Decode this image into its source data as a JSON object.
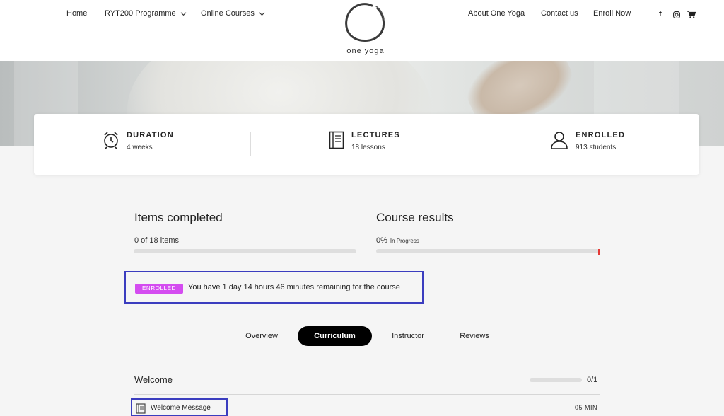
{
  "nav": {
    "home": "Home",
    "programme": "RYT200 Programme",
    "courses": "Online Courses",
    "about": "About One Yoga",
    "contact": "Contact us",
    "enroll": "Enroll Now"
  },
  "logo": {
    "text": "one yoga"
  },
  "social": {
    "facebook": "f",
    "instagram": "instagram-icon",
    "cart": "cart-icon"
  },
  "stats": {
    "duration": {
      "title": "DURATION",
      "value": "4 weeks",
      "icon": "alarm-clock-icon"
    },
    "lectures": {
      "title": "LECTURES",
      "value": "18 lessons",
      "icon": "book-icon"
    },
    "enrolled": {
      "title": "ENROLLED",
      "value": "913 students",
      "icon": "user-icon"
    }
  },
  "progress": {
    "items_title": "Items completed",
    "items_sub": "0 of 18 items",
    "items_fraction": 0,
    "results_title": "Course results",
    "results_percent": "0%",
    "results_status": "In Progress"
  },
  "notice": {
    "badge": "ENROLLED",
    "text": "You have 1 day 14 hours 46 minutes remaining for the course"
  },
  "tabs": {
    "overview": "Overview",
    "curriculum": "Curriculum",
    "instructor": "Instructor",
    "reviews": "Reviews",
    "active": "Curriculum"
  },
  "curriculum": {
    "section_title": "Welcome",
    "section_count": "0/1",
    "lesson_title": "Welcome Message",
    "lesson_duration": "05 MIN"
  },
  "colors": {
    "badge": "#d44cf0",
    "highlight_border": "#3b3dbf",
    "progress_marker": "#e53935",
    "active_tab": "#000000"
  }
}
